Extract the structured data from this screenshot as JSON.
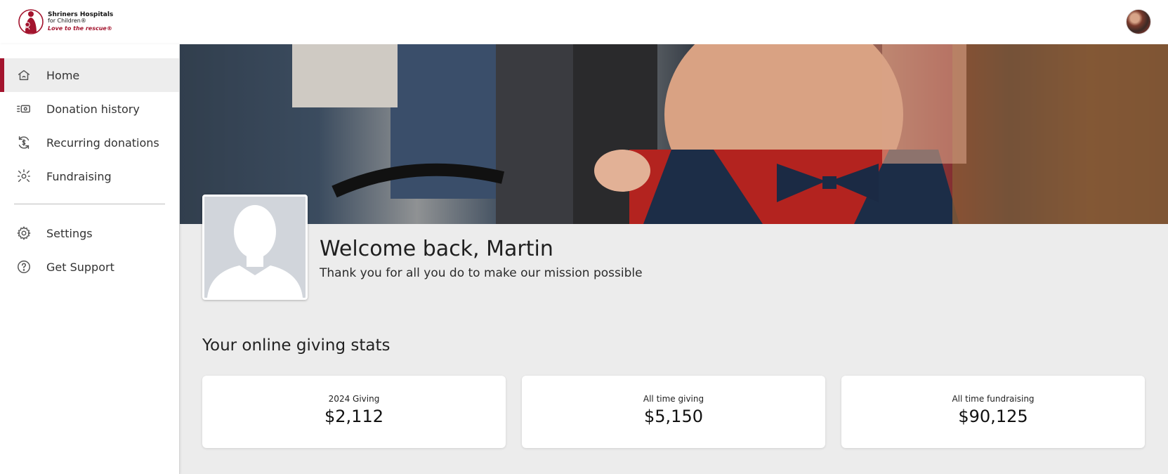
{
  "header": {
    "logo": {
      "line1": "Shriners Hospitals",
      "line2": "for Children®",
      "tagline": "Love to the rescue®",
      "icon": "shriners-emblem-icon"
    },
    "avatar_icon": "user-avatar"
  },
  "sidebar": {
    "items": [
      {
        "label": "Home",
        "icon": "home-icon",
        "active": true
      },
      {
        "label": "Donation history",
        "icon": "money-icon",
        "active": false
      },
      {
        "label": "Recurring donations",
        "icon": "recurring-dollar-icon",
        "active": false
      },
      {
        "label": "Fundraising",
        "icon": "fundraising-icon",
        "active": false
      }
    ],
    "secondary": [
      {
        "label": "Settings",
        "icon": "gear-icon"
      },
      {
        "label": "Get Support",
        "icon": "help-icon"
      }
    ]
  },
  "profile": {
    "welcome": "Welcome back, Martin",
    "subtitle": "Thank you for all you do to make our mission possible"
  },
  "stats": {
    "heading": "Your online giving stats",
    "cards": [
      {
        "label": "2024 Giving",
        "value": "$2,112"
      },
      {
        "label": "All time giving",
        "value": "$5,150"
      },
      {
        "label": "All time fundraising",
        "value": "$90,125"
      }
    ]
  },
  "colors": {
    "brand": "#a3142e",
    "sidebar_active_bg": "#ededed",
    "page_bg": "#ececec"
  }
}
